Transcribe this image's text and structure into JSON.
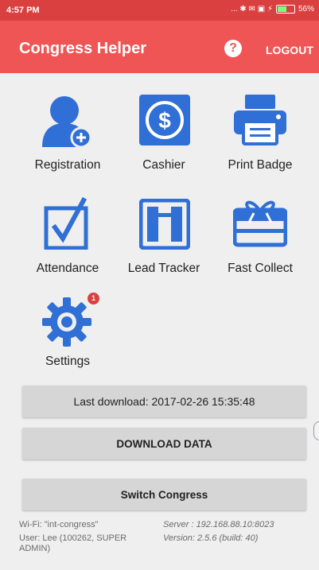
{
  "status_bar": {
    "time": "4:57 PM",
    "icons_text": "... ✱ ✉ ▣ ⚡",
    "battery": "56%"
  },
  "header": {
    "title": "Congress Helper",
    "help_icon": "?",
    "logout_label": "LOGOUT"
  },
  "menu": [
    {
      "label": "Registration",
      "icon": "add-user-icon"
    },
    {
      "label": "Cashier",
      "icon": "dollar-icon"
    },
    {
      "label": "Print Badge",
      "icon": "printer-icon"
    },
    {
      "label": "Attendance",
      "icon": "checkbox-icon"
    },
    {
      "label": "Lead Tracker",
      "icon": "lead-tracker-icon"
    },
    {
      "label": "Fast Collect",
      "icon": "gift-card-icon"
    },
    {
      "label": "Settings",
      "icon": "gear-icon",
      "badge": "1"
    }
  ],
  "buttons": {
    "last_download": "Last download: 2017-02-26 15:35:48",
    "download_data": "DOWNLOAD DATA",
    "switch_congress": "Switch Congress"
  },
  "footer": {
    "wifi": "Wi-Fi: \"int-congress\"",
    "user": "User: Lee (100262, SUPER ADMIN)",
    "server": "Server : 192.168.88.10:8023",
    "version": "Version: 2.5.6 (build: 40)"
  },
  "colors": {
    "accent": "#f05555",
    "status_bar": "#d9403f",
    "icon_blue": "#2f6fd6",
    "background": "#efefef"
  }
}
